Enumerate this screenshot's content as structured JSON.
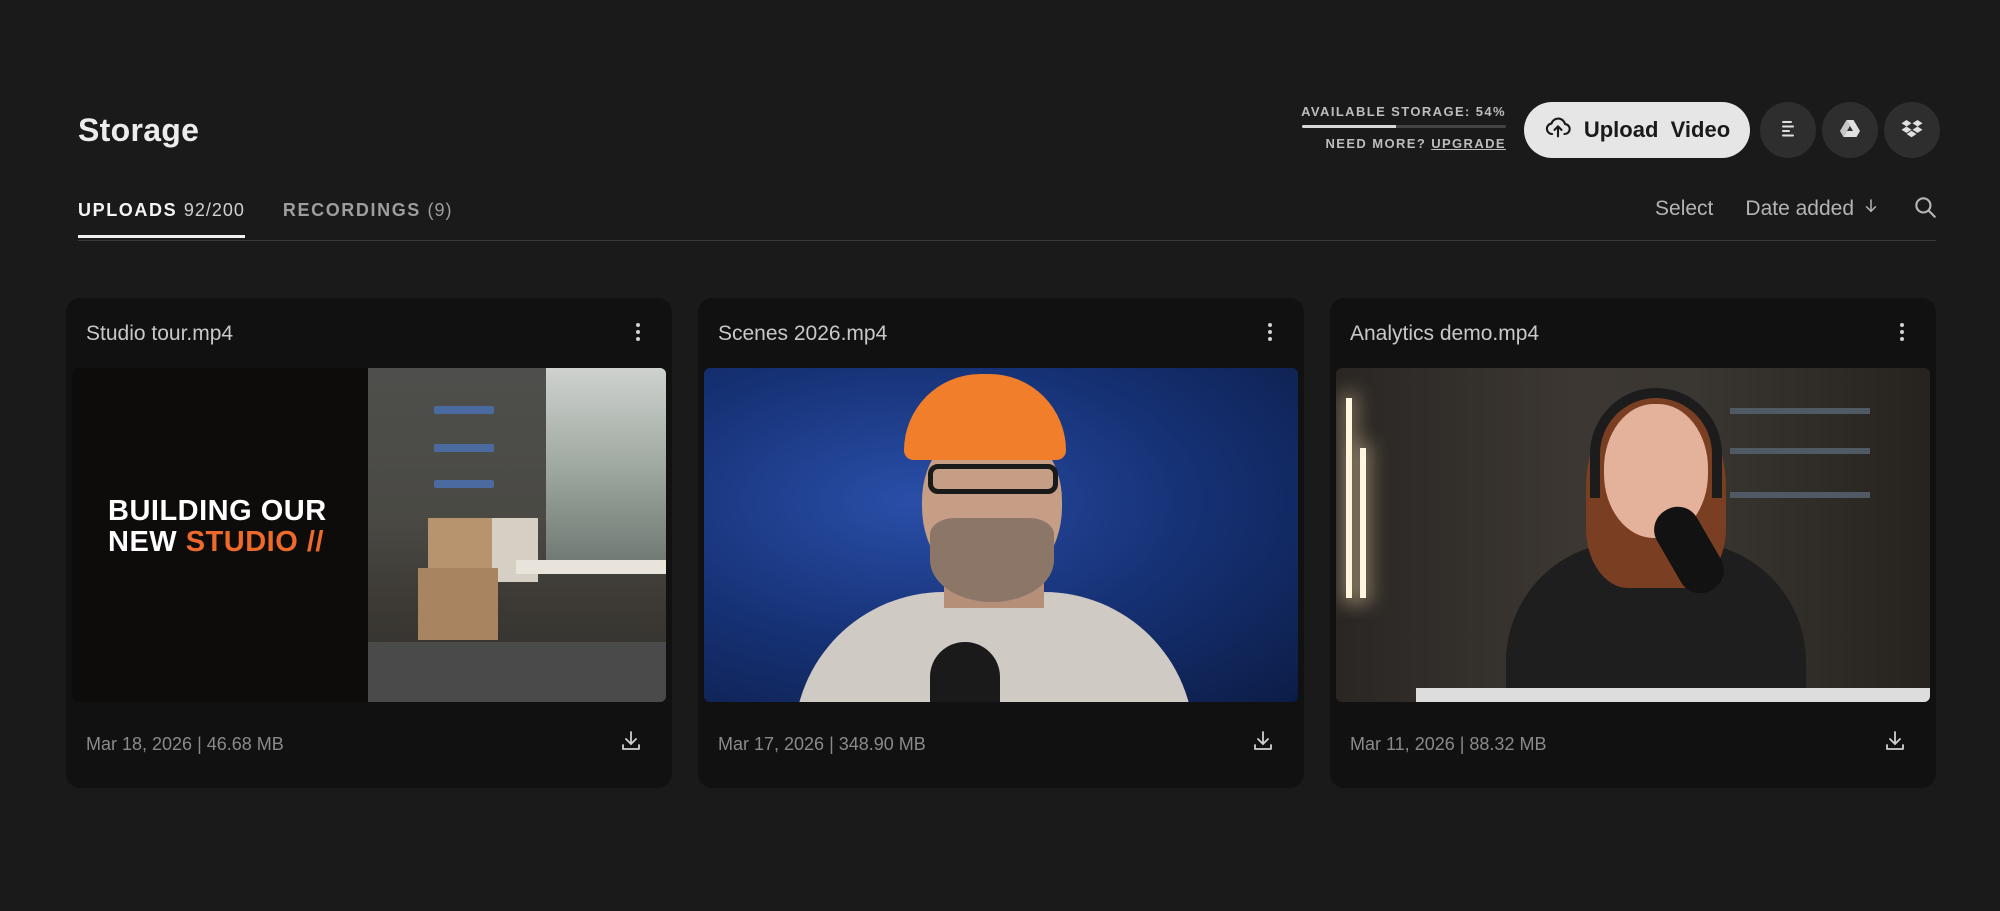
{
  "header": {
    "title": "Storage",
    "storage_label": "AVAILABLE STORAGE: 54%",
    "storage_available_percent": 54,
    "need_more": "NEED MORE?",
    "upgrade": "UPGRADE",
    "upload_label": "Upload  Video",
    "icons": [
      "upload-cloud-icon",
      "list-icon",
      "google-drive-icon",
      "dropbox-icon"
    ]
  },
  "tabs": [
    {
      "label": "UPLOADS",
      "count": "92/200",
      "active": true
    },
    {
      "label": "RECORDINGS",
      "count": "(9)",
      "active": false
    }
  ],
  "toolbar": {
    "select_label": "Select",
    "sort_label": "Date added",
    "icons": [
      "arrow-down-icon",
      "search-icon"
    ]
  },
  "cards": [
    {
      "title": "Studio tour.mp4",
      "meta": "Mar 18, 2026 | 46.68 MB",
      "thumb_text_line1": "BUILDING OUR",
      "thumb_text_line2_a": "NEW ",
      "thumb_text_line2_b": "STUDIO //"
    },
    {
      "title": "Scenes 2026.mp4",
      "meta": "Mar 17, 2026 | 348.90 MB"
    },
    {
      "title": "Analytics demo.mp4",
      "meta": "Mar 11, 2026 | 88.32 MB"
    }
  ],
  "colors": {
    "background": "#1a1a1a",
    "card": "#111111",
    "accent": "#ee6a2a"
  }
}
